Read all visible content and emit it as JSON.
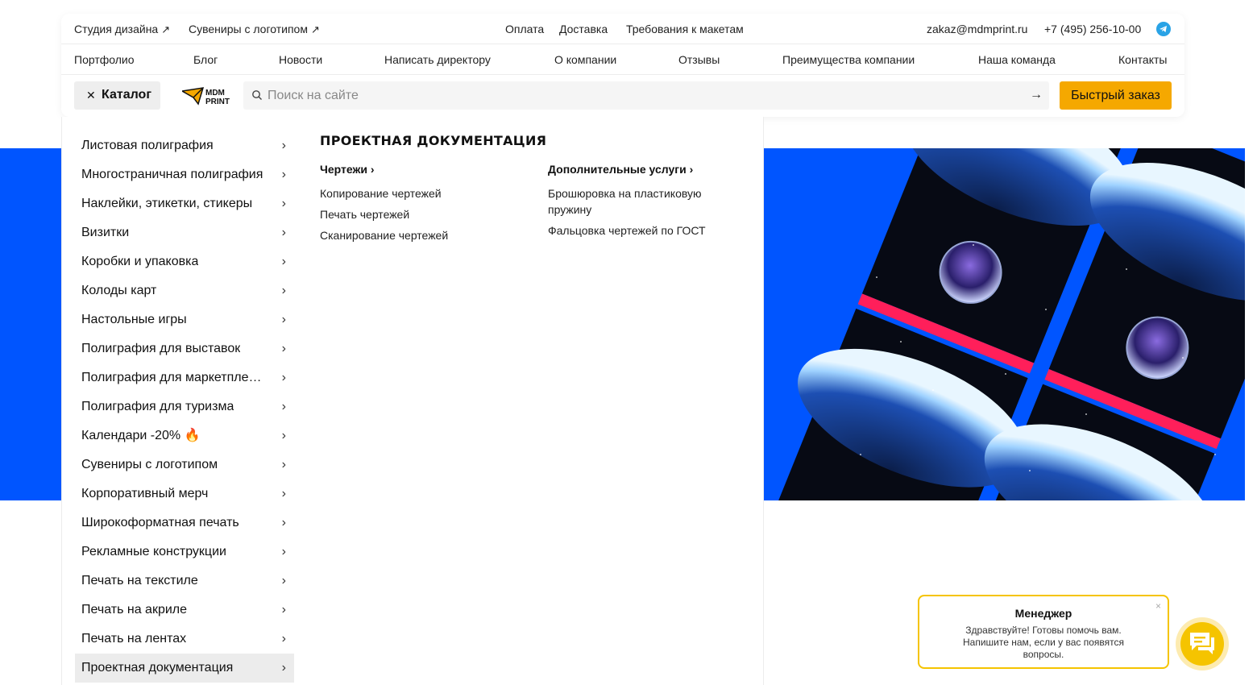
{
  "header": {
    "top_links": [
      {
        "label": "Студия дизайна",
        "arrow": "↗"
      },
      {
        "label": "Сувениры с логотипом",
        "arrow": "↗"
      }
    ],
    "info_links": [
      "Оплата",
      "Доставка",
      "Требования к макетам"
    ],
    "email": "zakaz@mdmprint.ru",
    "phone": "+7 (495) 256-10-00",
    "nav": [
      "Портфолио",
      "Блог",
      "Новости",
      "Написать директору",
      "О компании",
      "Отзывы",
      "Преимущества компании",
      "Наша команда",
      "Контакты"
    ],
    "catalog_label": "Каталог",
    "catalog_close_glyph": "✕",
    "logo_text": [
      "MDM",
      "PRINT"
    ],
    "search_placeholder": "Поиск на сайте",
    "search_submit_glyph": "→",
    "quick_order_label": "Быстрый заказ"
  },
  "catalog": {
    "categories": [
      "Листовая полиграфия",
      "Многостраничная полиграфия",
      "Наклейки, этикетки, стикеры",
      "Визитки",
      "Коробки и упаковка",
      "Колоды карт",
      "Настольные игры",
      "Полиграфия для выставок",
      "Полиграфия для маркетплейсов",
      "Полиграфия для туризма",
      "Календари -20% 🔥",
      "Сувениры с логотипом",
      "Корпоративный мерч",
      "Широкоформатная печать",
      "Рекламные конструкции",
      "Печать на текстиле",
      "Печать на акриле",
      "Печать на лентах",
      "Проектная документация"
    ],
    "active_category": "Проектная документация",
    "chevron": "›",
    "submenu": {
      "title": "ПРОЕКТНАЯ ДОКУМЕНТАЦИЯ",
      "columns": [
        {
          "heading": "Чертежи ›",
          "links": [
            "Копирование чертежей",
            "Печать чертежей",
            "Сканирование чертежей"
          ]
        },
        {
          "heading": "Дополнительные услуги ›",
          "links": [
            "Брошюровка на пластиковую пружину",
            "Фальцовка чертежей по ГОСТ"
          ]
        }
      ]
    }
  },
  "chat": {
    "title": "Менеджер",
    "message": "Здравствуйте! Готовы помочь вам. Напишите нам, если у вас появятся вопросы.",
    "close_glyph": "×"
  },
  "colors": {
    "hero_blue": "#0055ff",
    "accent_yellow": "#f5a800",
    "chat_yellow": "#f5c400",
    "telegram_blue": "#29a3e6",
    "active_item_bg": "#ececec"
  },
  "icons": [
    "arrow-ne-icon",
    "telegram-icon",
    "close-icon",
    "logo-icon",
    "search-icon",
    "arrow-right-icon",
    "chevron-right-icon",
    "chat-icon"
  ]
}
